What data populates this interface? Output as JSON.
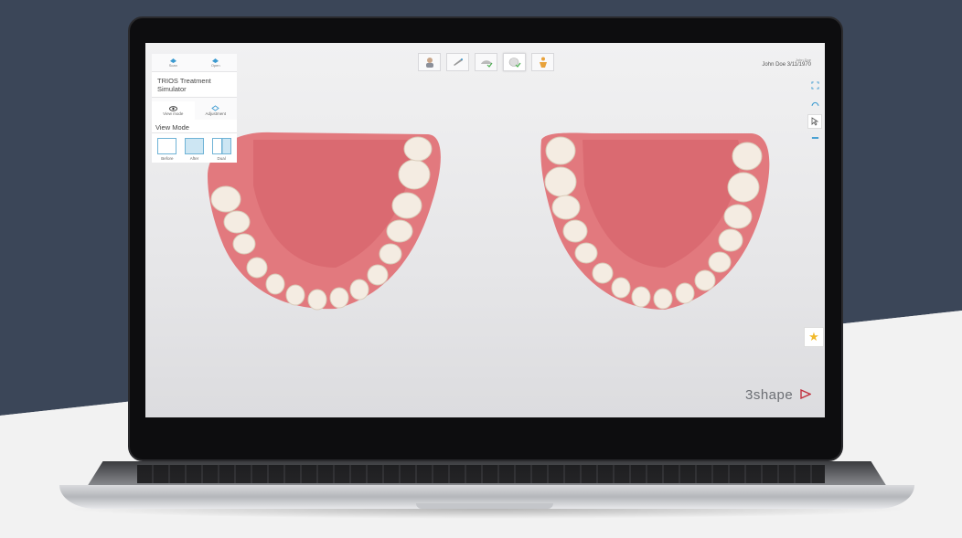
{
  "panel": {
    "top_buttons": [
      {
        "label": "Scan",
        "icon": "scan-icon"
      },
      {
        "label": "Open",
        "icon": "open-icon"
      }
    ],
    "title": "TRIOS Treatment Simulator",
    "tabs": [
      {
        "label": "View mode",
        "icon": "eye-icon",
        "active": true
      },
      {
        "label": "Adjustment",
        "icon": "adjust-icon",
        "active": false
      }
    ],
    "section_title": "View Mode",
    "modes": [
      {
        "label": "Before",
        "key": "before"
      },
      {
        "label": "After",
        "key": "after"
      },
      {
        "label": "Dual",
        "key": "dual"
      }
    ]
  },
  "toolbar": [
    {
      "icon": "patient-face-icon",
      "active": false
    },
    {
      "icon": "scanner-icon",
      "active": false
    },
    {
      "icon": "jaw-check-icon",
      "active": false
    },
    {
      "icon": "tooth-check-icon",
      "active": true
    },
    {
      "icon": "treatment-icon",
      "active": false
    }
  ],
  "patient": {
    "line1": "John Doe",
    "line2": "John Doe 3/11/1970"
  },
  "right_controls": [
    "fullscreen-icon",
    "rotate-up-icon",
    "cursor-select-icon",
    "minimize-icon"
  ],
  "favorite_icon": "star-icon",
  "favorite_glyph": "★",
  "brand": "3shape",
  "colors": {
    "background_dark": "#3b4658",
    "accent_blue": "#6fb3d6",
    "gum": "#e77f83",
    "brand_red": "#c2313f"
  }
}
